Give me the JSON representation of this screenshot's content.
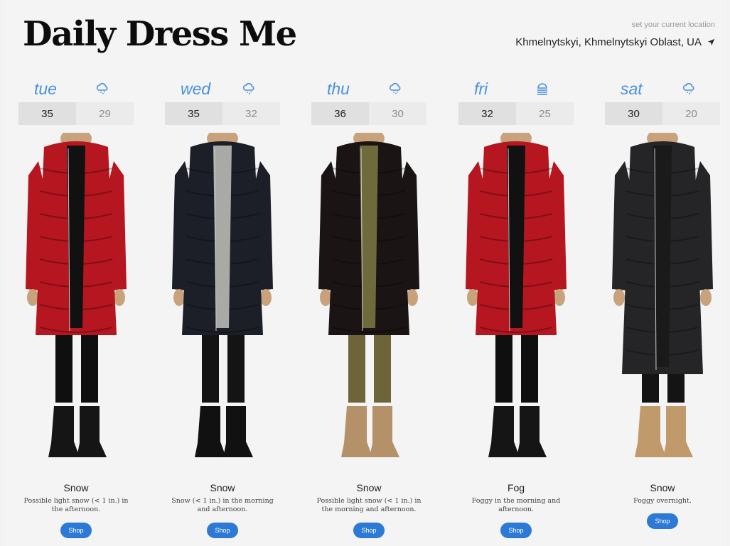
{
  "header": {
    "logo": "Daily Dress Me",
    "location_hint": "set your current location",
    "location": "Khmelnytskyi, Khmelnytskyi Oblast, UA"
  },
  "days": [
    {
      "name": "tue",
      "icon": "rain-cloud-icon",
      "high": "35",
      "low": "29",
      "summary": "Snow",
      "description": "Possible light snow (< 1 in.) in the afternoon.",
      "shop_label": "Shop",
      "coat_color": "#b5161f",
      "pants_color": "#0f0f0f",
      "top_color": "#111111",
      "boot_color": "#151515"
    },
    {
      "name": "wed",
      "icon": "rain-cloud-icon",
      "high": "35",
      "low": "32",
      "summary": "Snow",
      "description": "Snow (< 1 in.) in the morning and afternoon.",
      "shop_label": "Shop",
      "coat_color": "#1c1f27",
      "pants_color": "#141414",
      "top_color": "#a9aaa6",
      "boot_color": "#111111"
    },
    {
      "name": "thu",
      "icon": "rain-cloud-icon",
      "high": "36",
      "low": "30",
      "summary": "Snow",
      "description": "Possible light snow (< 1 in.) in the morning and afternoon.",
      "shop_label": "Shop",
      "coat_color": "#1a1414",
      "pants_color": "#6d6539",
      "top_color": "#6f6a3c",
      "boot_color": "#b49169"
    },
    {
      "name": "fri",
      "icon": "fog-icon",
      "high": "32",
      "low": "25",
      "summary": "Fog",
      "description": "Foggy in the morning and afternoon.",
      "shop_label": "Shop",
      "coat_color": "#b5161f",
      "pants_color": "#0f0f0f",
      "top_color": "#111111",
      "boot_color": "#151515"
    },
    {
      "name": "sat",
      "icon": "rain-cloud-icon",
      "high": "30",
      "low": "20",
      "summary": "Snow",
      "description": "Foggy overnight.",
      "shop_label": "Shop",
      "coat_color": "#252427",
      "pants_color": "#141414",
      "top_color": "#1a1a1a",
      "boot_color": "#c19a6c"
    }
  ],
  "colors": {
    "accent": "#4a90e2",
    "button": "#2d7ad6"
  }
}
